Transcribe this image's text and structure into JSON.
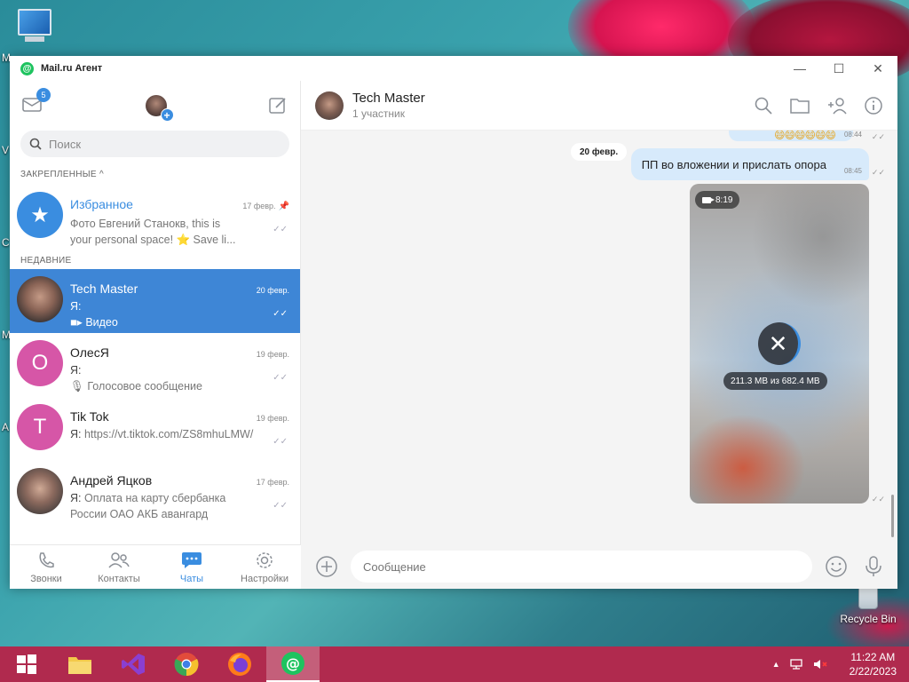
{
  "desktop": {
    "icons": [
      {
        "label": "M"
      },
      {
        "label": "Recycle Bin"
      }
    ],
    "edge_letters": [
      "V",
      "C",
      "M",
      "A"
    ]
  },
  "window": {
    "title": "Mail.ru Агент",
    "controls": {
      "minimize": "—",
      "maximize": "☐",
      "close": "✕"
    }
  },
  "sidebar": {
    "unread_badge": "5",
    "search_placeholder": "Поиск",
    "pinned_label": "ЗАКРЕПЛЕННЫЕ ^",
    "recent_label": "НЕДАВНИЕ",
    "pinned": [
      {
        "name": "Избранное",
        "date": "17 февр.",
        "line1": "Фото Евгений Станокв, this is",
        "line2": "your personal space! ⭐ Save li..."
      }
    ],
    "chats": [
      {
        "name": "Tech Master",
        "date": "20 февр.",
        "line1": "Я:",
        "line2": "Видео",
        "avatar_type": "photo"
      },
      {
        "name": "ОлесЯ",
        "date": "19 февр.",
        "line1": "Я:",
        "line2": "Голосовое сообщение",
        "avatar_letter": "О"
      },
      {
        "name": "Tik Tok",
        "date": "19 февр.",
        "line1_me": "Я:",
        "line1": "https://vt.tiktok.com/ZS8mhuLMW/",
        "avatar_letter": "T"
      },
      {
        "name": "Андрей Яцков",
        "date": "17 февр.",
        "line1_me": "Я:",
        "line1": "Оплата на карту сбербанка",
        "line2": "России ОАО АКБ авангард",
        "avatar_type": "photo"
      }
    ],
    "tabs": [
      {
        "label": "Звонки",
        "icon": "phone-icon"
      },
      {
        "label": "Контакты",
        "icon": "contacts-icon"
      },
      {
        "label": "Чаты",
        "icon": "chat-icon"
      },
      {
        "label": "Настройки",
        "icon": "settings-icon"
      }
    ]
  },
  "conversation": {
    "title": "Tech Master",
    "subtitle": "1 участник",
    "top_time": "08:44",
    "date_chip": "20 февр.",
    "message_text": "ПП во вложении и прислать опора",
    "message_time": "08:45",
    "video_duration": "8:19",
    "download_progress": "211.3 MB из 682.4 MB",
    "download_fraction": 0.31,
    "composer_placeholder": "Сообщение"
  },
  "taskbar": {
    "time": "11:22 AM",
    "date": "2/22/2023"
  },
  "colors": {
    "accent": "#3a8de0",
    "active_row": "#3e86d6",
    "bubble": "#d7eafb",
    "taskbar": "#b02a4e"
  }
}
